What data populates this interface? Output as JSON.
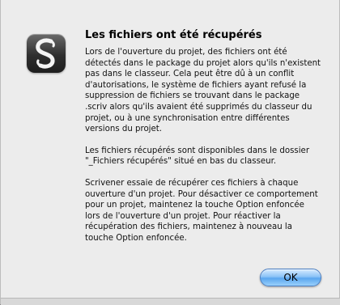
{
  "dialog": {
    "title": "Les fichiers ont été récupérés",
    "paragraphs": [
      "Lors de l'ouverture du projet, des fichiers ont été détectés dans le package du projet alors qu'ils n'existent pas dans le classeur. Cela peut être dû à un conflit d'autorisations, le système de fichiers ayant refusé la suppression de fichiers se trouvant dans le package .scriv alors qu'ils avaient été supprimés du classeur du projet, ou à une synchronisation entre différentes versions du projet.",
      "Les fichiers récupérés sont disponibles dans le dossier \"_Fichiers récupérés\" situé en bas du classeur.",
      "Scrivener essaie de récupérer ces fichiers à chaque ouverture d'un projet. Pour désactiver ce comportement pour un projet, maintenez la touche Option enfoncée lors de l'ouverture d'un projet. Pour réactiver la récupération des fichiers, maintenez à nouveau la touche Option enfoncée."
    ],
    "ok_label": "OK",
    "icon": "scrivener-app-icon"
  }
}
